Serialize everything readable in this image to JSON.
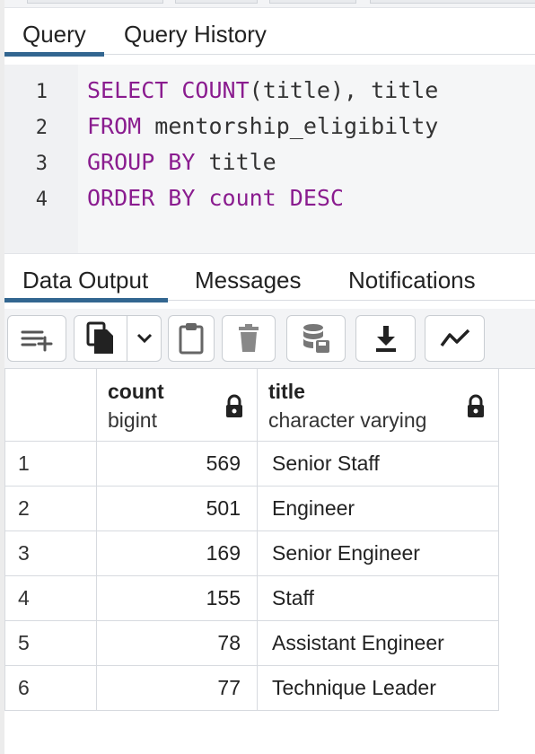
{
  "query_tabs": {
    "items": [
      {
        "label": "Query",
        "active": true
      },
      {
        "label": "Query History",
        "active": false
      }
    ]
  },
  "editor": {
    "lines": [
      {
        "num": "1",
        "tokens": [
          {
            "t": "SELECT",
            "kw": true
          },
          {
            "t": " ",
            "kw": false
          },
          {
            "t": "COUNT",
            "kw": true
          },
          {
            "t": "(title), title",
            "kw": false
          }
        ]
      },
      {
        "num": "2",
        "tokens": [
          {
            "t": "FROM",
            "kw": true
          },
          {
            "t": " mentorship_eligibilty",
            "kw": false
          }
        ]
      },
      {
        "num": "3",
        "tokens": [
          {
            "t": "GROUP BY",
            "kw": true
          },
          {
            "t": " title",
            "kw": false
          }
        ]
      },
      {
        "num": "4",
        "tokens": [
          {
            "t": "ORDER BY count DESC",
            "kw": true
          }
        ]
      }
    ],
    "colors": {
      "keyword": "#8a1c8f",
      "plain": "#333333"
    }
  },
  "output_tabs": {
    "items": [
      {
        "label": "Data Output",
        "active": true
      },
      {
        "label": "Messages",
        "active": false
      },
      {
        "label": "Notifications",
        "active": false
      }
    ]
  },
  "toolbar": {
    "buttons": [
      {
        "name": "add-row-button",
        "icon": "add-row-icon"
      },
      {
        "name": "copy-button",
        "icon": "copy-icon"
      },
      {
        "name": "copy-options-dropdown",
        "icon": "chevron-down-icon"
      },
      {
        "name": "paste-button",
        "icon": "clipboard-icon"
      },
      {
        "name": "delete-button",
        "icon": "trash-icon"
      },
      {
        "name": "save-data-button",
        "icon": "database-save-icon"
      },
      {
        "name": "download-button",
        "icon": "download-icon"
      },
      {
        "name": "graph-button",
        "icon": "line-graph-icon"
      }
    ]
  },
  "results": {
    "columns": [
      {
        "name": "count",
        "type": "bigint",
        "icon": "lock-icon"
      },
      {
        "name": "title",
        "type": "character varying",
        "icon": "lock-icon"
      }
    ],
    "rows": [
      {
        "n": "1",
        "count": "569",
        "title": "Senior Staff"
      },
      {
        "n": "2",
        "count": "501",
        "title": "Engineer"
      },
      {
        "n": "3",
        "count": "169",
        "title": "Senior Engineer"
      },
      {
        "n": "4",
        "count": "155",
        "title": "Staff"
      },
      {
        "n": "5",
        "count": "78",
        "title": "Assistant Engineer"
      },
      {
        "n": "6",
        "count": "77",
        "title": "Technique Leader"
      }
    ]
  },
  "accent_color": "#326690"
}
